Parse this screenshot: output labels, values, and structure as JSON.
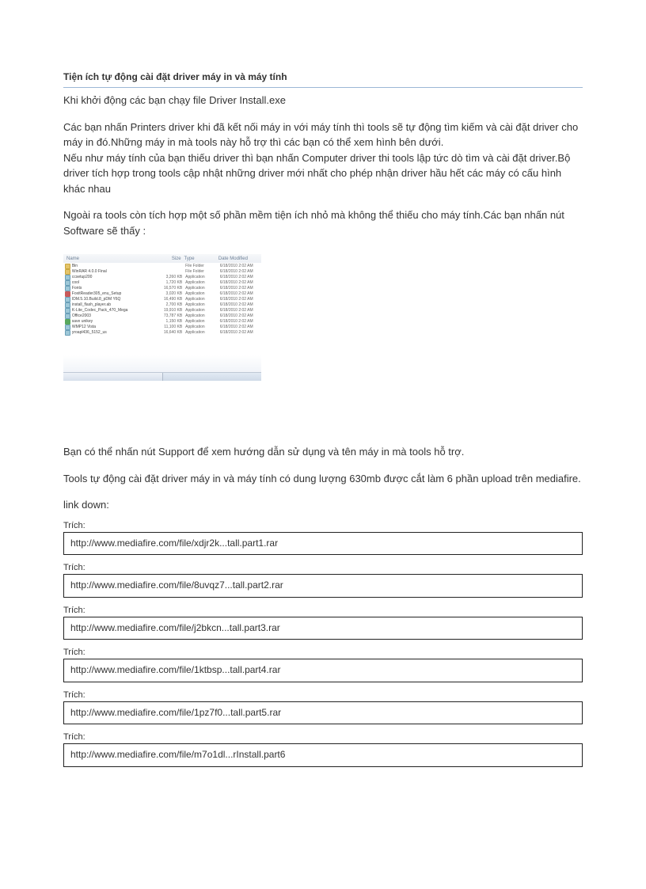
{
  "title": "Tiện ích tự động cài đặt driver máy in và máy tính",
  "intro": "Khi khởi động các bạn chạy file Driver Install.exe",
  "para1": "Các bạn nhấn Printers driver khi đã kết nối máy in với máy tính thì tools sẽ tự động tìm kiếm và cài đặt driver cho máy in đó.Những máy in mà tools này hỗ trợ thì các bạn có thể xem hình bên dưới.",
  "para2": "Nếu như máy tính của bạn thiếu driver thì bạn nhấn Computer driver thi tools lập tức dò tìm và cài đặt driver.Bộ driver tích hợp trong tools cập nhật những driver mới nhất cho phép nhận driver hầu hết các máy có cấu hình khác nhau",
  "para3": "Ngoài ra tools còn tích hợp một số phần mềm tiện ích nhỏ mà không thể thiếu cho máy tính.Các bạn nhấn nút Software sẽ thấy :",
  "filelist": {
    "headers": {
      "name": "Name",
      "size": "Size",
      "type": "Type",
      "date": "Date Modified"
    },
    "rows": [
      {
        "icon": "fld",
        "name": "Bin",
        "size": "",
        "type": "File Folder",
        "date": "6/18/2010 2:02 AM"
      },
      {
        "icon": "fld",
        "name": "WinRAR 4.0.0 Final",
        "size": "",
        "type": "File Folder",
        "date": "6/18/2010 2:02 AM"
      },
      {
        "icon": "app",
        "name": "ccsetup200",
        "size": "3,260 KB",
        "type": "Application",
        "date": "6/18/2010 2:02 AM"
      },
      {
        "icon": "app",
        "name": "cool",
        "size": "1,720 KB",
        "type": "Application",
        "date": "6/18/2010 2:02 AM"
      },
      {
        "icon": "app",
        "name": "Fonts",
        "size": "16,570 KB",
        "type": "Application",
        "date": "6/18/2010 2:02 AM"
      },
      {
        "icon": "red",
        "name": "FoxitReader305_enu_Setup",
        "size": "3,020 KB",
        "type": "Application",
        "date": "6/18/2010 2:02 AM"
      },
      {
        "icon": "app",
        "name": "IDM.5.10.Build.8_pDM Y6Q",
        "size": "16,490 KB",
        "type": "Application",
        "date": "6/18/2010 2:02 AM"
      },
      {
        "icon": "app",
        "name": "install_flash_player.ab",
        "size": "2,700 KB",
        "type": "Application",
        "date": "6/18/2010 2:02 AM"
      },
      {
        "icon": "app",
        "name": "K-Lite_Codec_Pack_470_Mega",
        "size": "19,910 KB",
        "type": "Application",
        "date": "6/18/2010 2:02 AM"
      },
      {
        "icon": "app",
        "name": "Office2003",
        "size": "73,787 KB",
        "type": "Application",
        "date": "6/18/2010 2:02 AM"
      },
      {
        "icon": "grn",
        "name": "save unikey",
        "size": "1,150 KB",
        "type": "Application",
        "date": "6/18/2010 2:02 AM"
      },
      {
        "icon": "app",
        "name": "WMP12  Vista",
        "size": "11,100 KB",
        "type": "Application",
        "date": "6/18/2010 2:02 AM"
      },
      {
        "icon": "app",
        "name": "yroapl436_5152_us",
        "size": "16,640 KB",
        "type": "Application",
        "date": "6/18/2010 2:02 AM"
      }
    ]
  },
  "para4": "Bạn có thể nhấn nút Support để xem hướng dẫn sử dụng và tên máy in mà tools hỗ trợ.",
  "para5": "Tools tự động cài đặt driver máy in và máy tính có dung lượng 630mb được cắt làm 6 phần upload trên mediafire.",
  "linkdown": "link down:",
  "quote_label": "Trích:",
  "links": [
    "http://www.mediafire.com/file/xdjr2k...tall.part1.rar",
    "http://www.mediafire.com/file/8uvqz7...tall.part2.rar",
    "http://www.mediafire.com/file/j2bkcn...tall.part3.rar",
    "http://www.mediafire.com/file/1ktbsp...tall.part4.rar",
    "http://www.mediafire.com/file/1pz7f0...tall.part5.rar",
    "http://www.mediafire.com/file/m7o1dl...rInstall.part6"
  ]
}
